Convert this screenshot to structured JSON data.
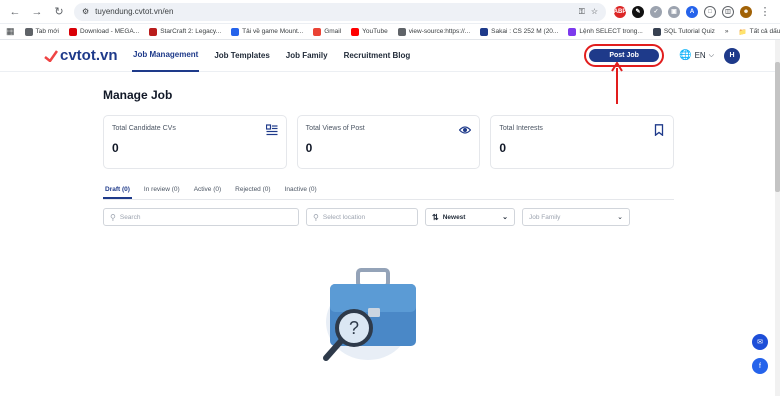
{
  "browser": {
    "url": "tuyendung.cvtot.vn/en",
    "bookmarks": [
      {
        "label": "Tab mới",
        "color": "#5f6368"
      },
      {
        "label": "Download - MEGA...",
        "color": "#d90007"
      },
      {
        "label": "StarCraft 2: Legacy...",
        "color": "#b91c1c"
      },
      {
        "label": "Tải về game Mount...",
        "color": "#2563eb"
      },
      {
        "label": "Gmail",
        "color": "#ea4335"
      },
      {
        "label": "YouTube",
        "color": "#ff0000"
      },
      {
        "label": "view-source:https://...",
        "color": "#5f6368"
      },
      {
        "label": "Sakai : CS 252 M (20...",
        "color": "#1e3a8a"
      },
      {
        "label": "Lệnh SELECT trong...",
        "color": "#7c3aed"
      },
      {
        "label": "SQL Tutorial Quiz",
        "color": "#374151"
      }
    ],
    "bookmarks_more": "»",
    "all_bookmarks": "Tất cả dấu trang"
  },
  "header": {
    "logo_text": "cvtot.vn",
    "nav": [
      "Job Management",
      "Job Templates",
      "Job Family",
      "Recruitment Blog"
    ],
    "post_job": "Post Job",
    "lang": "EN",
    "avatar": "H"
  },
  "main": {
    "title": "Manage Job",
    "stats": [
      {
        "label": "Total Candidate CVs",
        "value": "0",
        "icon": "cv-list-icon"
      },
      {
        "label": "Total Views of Post",
        "value": "0",
        "icon": "eye-icon"
      },
      {
        "label": "Total Interests",
        "value": "0",
        "icon": "bookmark-icon"
      }
    ],
    "tabs": [
      "Draft (0)",
      "In review (0)",
      "Active (0)",
      "Rejected (0)",
      "Inactive (0)"
    ],
    "filters": {
      "search_placeholder": "Search",
      "location_placeholder": "Select location",
      "sort": "Newest",
      "family_placeholder": "Job Family"
    }
  },
  "colors": {
    "brand": "#1e3a8a",
    "annotation": "#e11d1d"
  }
}
